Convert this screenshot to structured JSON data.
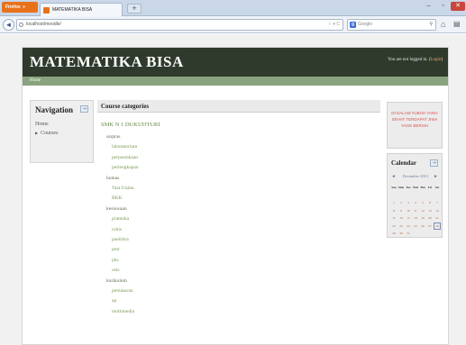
{
  "browser": {
    "app_button": "Firefox",
    "tab_title": "MATEMATIKA BISA",
    "new_tab": "+",
    "url": "localhost/moodle/",
    "search_engine": "Google",
    "search_placeholder": "Google"
  },
  "site": {
    "title": "MATEMATIKA BISA",
    "login_text": "You are not logged in. (",
    "login_link": "Login",
    "login_close": ")",
    "breadcrumb_home": "Home"
  },
  "navigation": {
    "title": "Navigation",
    "home": "Home",
    "courses": "Courses"
  },
  "main": {
    "heading": "Course categories",
    "categories": [
      {
        "label": "SMK N 1 DUKUHTURI",
        "level": 0
      },
      {
        "label": "sarpras",
        "level": 1
      },
      {
        "label": "laboratorium",
        "level": 2
      },
      {
        "label": "perpustakaan",
        "level": 2
      },
      {
        "label": "perlengkapan",
        "level": 2
      },
      {
        "label": "humas",
        "level": 1
      },
      {
        "label": "Tata Usaha",
        "level": 2
      },
      {
        "label": "BKK",
        "level": 2
      },
      {
        "label": "kesiswaan",
        "level": 1
      },
      {
        "label": "pramuka",
        "level": 2
      },
      {
        "label": "rohis",
        "level": 2
      },
      {
        "label": "paskibra",
        "level": 2
      },
      {
        "label": "pmr",
        "level": 2
      },
      {
        "label": "pks",
        "level": 2
      },
      {
        "label": "osis",
        "level": 2
      },
      {
        "label": "kurikulum",
        "level": 1
      },
      {
        "label": "pemasaran",
        "level": 2
      },
      {
        "label": "ap",
        "level": 2
      },
      {
        "label": "multimedia",
        "level": 2
      }
    ]
  },
  "motto": {
    "line1": "DI DALAM TUBUH YANG",
    "line2": "SEHAT TERDAPAT JIWA",
    "line3": "YANG BERSIH"
  },
  "calendar": {
    "title": "Calendar",
    "month": "December 2013",
    "prev": "◄",
    "next": "►",
    "weekdays": [
      "Sun",
      "Mon",
      "Tue",
      "Wed",
      "Thu",
      "Fri",
      "Sat"
    ],
    "weeks": [
      [
        "",
        "",
        "",
        "",
        "",
        "",
        ""
      ],
      [
        "1",
        "2",
        "3",
        "4",
        "5",
        "6",
        "7"
      ],
      [
        "8",
        "9",
        "10",
        "11",
        "12",
        "13",
        "14"
      ],
      [
        "15",
        "16",
        "17",
        "18",
        "19",
        "20",
        "21"
      ],
      [
        "22",
        "23",
        "24",
        "25",
        "26",
        "27",
        "28"
      ],
      [
        "29",
        "30",
        "31",
        "",
        "",
        "",
        ""
      ]
    ],
    "today": "28"
  },
  "colors": {
    "header_bg": "#2f3a2c",
    "subnav_bg": "#8aa37f",
    "category_link": "#6a8a4a",
    "motto_text": "#d9534f",
    "calendar_day": "#b85a3a"
  }
}
